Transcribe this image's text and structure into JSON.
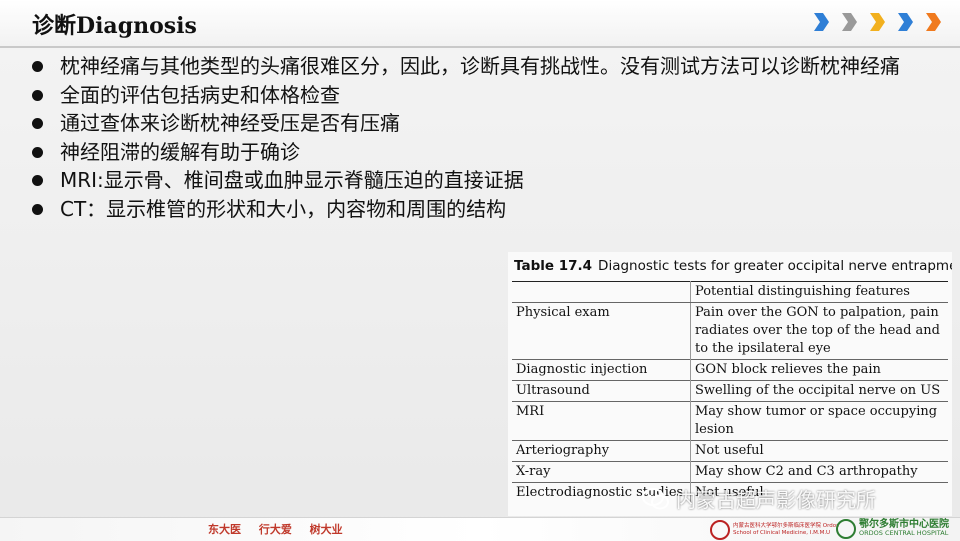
{
  "header": {
    "title": "诊断Diagnosis",
    "chevron_colors": [
      "#2f7fd6",
      "#9a9a9a",
      "#f2b01e",
      "#2f7fd6",
      "#f07a1e"
    ]
  },
  "bullets": [
    "枕神经痛与其他类型的头痛很难区分，因此，诊断具有挑战性。没有测试方法可以诊断枕神经痛",
    "全面的评估包括病史和体格检查",
    "通过查体来诊断枕神经受压是否有压痛",
    "神经阻滞的缓解有助于确诊",
    "MRI:显示骨、椎间盘或血肿显示脊髓压迫的直接证据",
    "CT：显示椎管的形状和大小，内容物和周围的结构"
  ],
  "table": {
    "caption_label": "Table 17.4",
    "caption_text": "Diagnostic tests for greater occipital nerve entrapment",
    "header": [
      "",
      "Potential distinguishing features"
    ],
    "rows": [
      {
        "test": "Physical exam",
        "feature": "Pain over the GON to palpation, pain radiates over the top of the head and to the ipsilateral eye"
      },
      {
        "test": "Diagnostic injection",
        "feature": "GON block relieves the pain"
      },
      {
        "test": "Ultrasound",
        "feature": "Swelling of the occipital nerve on US"
      },
      {
        "test": "MRI",
        "feature": "May show tumor or space occupying lesion"
      },
      {
        "test": "Arteriography",
        "feature": "Not useful"
      },
      {
        "test": "X-ray",
        "feature": "May show C2 and C3 arthropathy"
      },
      {
        "test": "Electrodiagnostic studies",
        "feature": "Not useful"
      }
    ]
  },
  "footer": {
    "motto": "东大医 行大爱 树大业",
    "logo_left": "内蒙古医科大学鄂尔多斯临床医学院 Ordos School of Clinical Medicine, I.M.M.U",
    "logo_right_cn": "鄂尔多斯市中心医院",
    "logo_right_en": "ORDOS CENTRAL HOSPITAL"
  },
  "watermark": "内蒙古超声影像研究所"
}
